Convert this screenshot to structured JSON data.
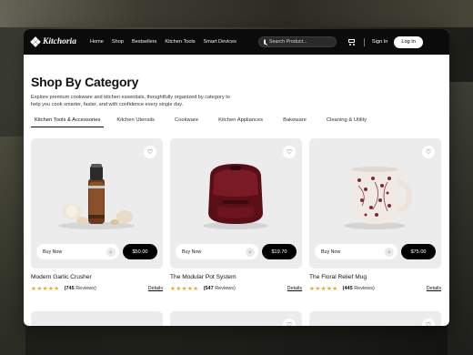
{
  "brand": {
    "name": "Kitchoria"
  },
  "nav": {
    "links": [
      "Home",
      "Shop",
      "Bestsellers",
      "Kitchen Tools",
      "Smart Devices"
    ],
    "search_placeholder": "Search Product...",
    "signin_label": "Sign In",
    "login_label": "Log In"
  },
  "page": {
    "title": "Shop By Category",
    "subtitle": "Explore premium cookware and kitchen essentials, thoughtfully organized by category to help you cook smarter, faster, and with confidence every single day."
  },
  "tabs": [
    {
      "label": "Kitchen Tools & Accessories",
      "active": true
    },
    {
      "label": "Kitchen Utensils",
      "active": false
    },
    {
      "label": "Cookware",
      "active": false
    },
    {
      "label": "Kitchen Appliances",
      "active": false
    },
    {
      "label": "Bakeware",
      "active": false
    },
    {
      "label": "Cleaning & Utility",
      "active": false
    }
  ],
  "products": [
    {
      "name": "Modern Garlic Crusher",
      "price": "$50.00",
      "buy_label": "Buy Now",
      "reviews_count": "(745",
      "reviews_word": "Reviews)",
      "rating": 5,
      "details_label": "Details",
      "icon": "garlic-crusher"
    },
    {
      "name": "The Modular Pot System",
      "price": "$19.70",
      "buy_label": "Buy Now",
      "reviews_count": "(547",
      "reviews_word": "Reviews)",
      "rating": 5,
      "details_label": "Details",
      "icon": "air-fryer"
    },
    {
      "name": "The Floral Relief Mug",
      "price": "$75.00",
      "buy_label": "Buy Now",
      "reviews_count": "(445",
      "reviews_word": "Reviews)",
      "rating": 5,
      "details_label": "Details",
      "icon": "floral-mug"
    }
  ],
  "colors": {
    "accent": "#000000",
    "star": "#e9a825",
    "card_bg": "#ececec",
    "nav_bg": "#0b0b0b"
  }
}
